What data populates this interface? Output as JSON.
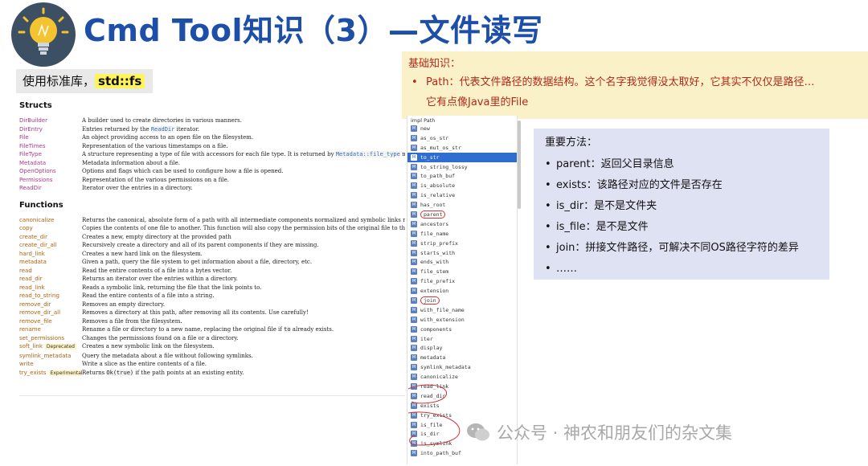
{
  "title": "Cmd Tool知识（3）—文件读写",
  "std_label": {
    "prefix": "使用标准库，",
    "code": "std::fs"
  },
  "basics": {
    "head": "基础知识：",
    "line1": "Path：代表文件路径的数据结构。这个名字我觉得没太取好，它其实不仅仅是路径…",
    "line2": "它有点像Java里的File"
  },
  "structs_title": "Structs",
  "structs": [
    {
      "name": "DirBuilder",
      "desc": "A builder used to create directories in various manners."
    },
    {
      "name": "DirEntry",
      "desc_pre": "Entries returned by the ",
      "code": "ReadDir",
      "desc_post": " iterator."
    },
    {
      "name": "File",
      "desc": "An object providing access to an open file on the filesystem."
    },
    {
      "name": "FileTimes",
      "desc": "Representation of the various timestamps on a file."
    },
    {
      "name": "FileType",
      "desc_pre": "A structure representing a type of file with accessors for each file type. It is returned by ",
      "code": "Metadata::file_type",
      "desc_post": " method."
    },
    {
      "name": "Metadata",
      "desc": "Metadata information about a file."
    },
    {
      "name": "OpenOptions",
      "desc": "Options and flags which can be used to configure how a file is opened."
    },
    {
      "name": "Permissions",
      "desc": "Representation of the various permissions on a file."
    },
    {
      "name": "ReadDir",
      "desc": "Iterator over the entries in a directory."
    }
  ],
  "functions_title": "Functions",
  "functions": [
    {
      "name": "canonicalize",
      "desc": "Returns the canonical, absolute form of a path with all intermediate components normalized and symbolic links resolved."
    },
    {
      "name": "copy",
      "desc": "Copies the contents of one file to another. This function will also copy the permission bits of the original file to the destination fil"
    },
    {
      "name": "create_dir",
      "desc": "Creates a new, empty directory at the provided path"
    },
    {
      "name": "create_dir_all",
      "desc": "Recursively create a directory and all of its parent components if they are missing."
    },
    {
      "name": "hard_link",
      "desc": "Creates a new hard link on the filesystem."
    },
    {
      "name": "metadata",
      "desc": "Given a path, query the file system to get information about a file, directory, etc."
    },
    {
      "name": "read",
      "desc": "Read the entire contents of a file into a bytes vector."
    },
    {
      "name": "read_dir",
      "desc": "Returns an iterator over the entries within a directory."
    },
    {
      "name": "read_link",
      "desc": "Reads a symbolic link, returning the file that the link points to."
    },
    {
      "name": "read_to_string",
      "desc": "Read the entire contents of a file into a string."
    },
    {
      "name": "remove_dir",
      "desc": "Removes an empty directory."
    },
    {
      "name": "remove_dir_all",
      "desc": "Removes a directory at this path, after removing all its contents. Use carefully!"
    },
    {
      "name": "remove_file",
      "desc": "Removes a file from the filesystem."
    },
    {
      "name": "rename",
      "desc_pre": "Rename a file or directory to a new name, replacing the original file if ",
      "code": "to",
      "desc_post": " already exists."
    },
    {
      "name": "set_permissions",
      "desc": "Changes the permissions found on a file or a directory."
    },
    {
      "name": "soft_link",
      "tag": "Deprecated",
      "desc": "Creates a new symbolic link on the filesystem."
    },
    {
      "name": "symlink_metadata",
      "desc": "Query the metadata about a file without following symlinks."
    },
    {
      "name": "write",
      "desc": "Write a slice as the entire contents of a file."
    },
    {
      "name": "try_exists",
      "tag": "Experimental",
      "desc_pre": "Returns ",
      "code": "Ok(true)",
      "desc_post": " if the path points at an existing entity."
    }
  ],
  "impl": {
    "head": "impl Path",
    "badge": "M",
    "items": [
      "new",
      "as_os_str",
      "as_mut_os_str",
      "to_str",
      "to_string_lossy",
      "to_path_buf",
      "is_absolute",
      "is_relative",
      "has_root",
      "parent",
      "ancestors",
      "file_name",
      "strip_prefix",
      "starts_with",
      "ends_with",
      "file_stem",
      "file_prefix",
      "extension",
      "join",
      "with_file_name",
      "with_extension",
      "components",
      "iter",
      "display",
      "metadata",
      "symlink_metadata",
      "canonicalize",
      "read_link",
      "read_dir",
      "exists",
      "try_exists",
      "is_file",
      "is_dir",
      "is_symlink",
      "into_path_buf"
    ],
    "selected": "to_str",
    "circled": [
      "parent",
      "join"
    ]
  },
  "methods": {
    "head": "重要方法：",
    "items": [
      "parent：返回父目录信息",
      "exists：该路径对应的文件是否存在",
      "is_dir：是不是文件夹",
      "is_file：是不是文件",
      "join：拼接文件路径，可解决不同OS路径字符的差异",
      "……"
    ]
  },
  "watermark": "公众号 · 神农和朋友们的杂文集",
  "colors": {
    "title": "#1d4fa8",
    "basics_bg": "#fbf1c9",
    "basics_text": "#b02a1a",
    "methods_bg": "#dfe2f3",
    "selected": "#2f6dcf",
    "annotation": "#d0353b"
  }
}
